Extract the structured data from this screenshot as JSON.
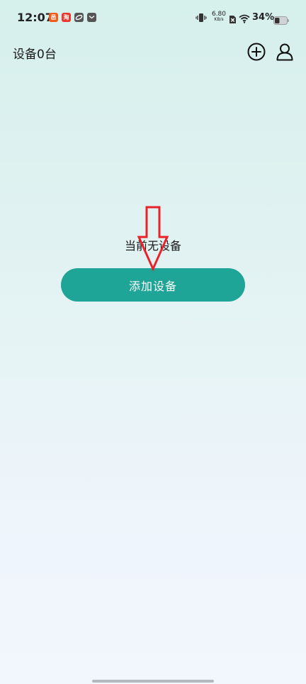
{
  "status_bar": {
    "time": "12:07",
    "app_icons": [
      {
        "name": "app-icon-orange",
        "glyph": "邑",
        "color": "#f25a1b"
      },
      {
        "name": "app-icon-taobao",
        "glyph": "淘",
        "color": "#f2362b"
      },
      {
        "name": "app-icon-link",
        "glyph": "",
        "color": "#555555"
      },
      {
        "name": "app-icon-message",
        "glyph": "",
        "color": "#555555"
      }
    ],
    "network_speed_value": "6.80",
    "network_speed_unit": "KB/s",
    "battery_percent": "34%"
  },
  "header": {
    "title": "设备0台"
  },
  "empty_state": {
    "message": "当前无设备",
    "add_button_label": "添加设备"
  },
  "colors": {
    "accent": "#1ea597",
    "annotation_red": "#e8232a"
  }
}
